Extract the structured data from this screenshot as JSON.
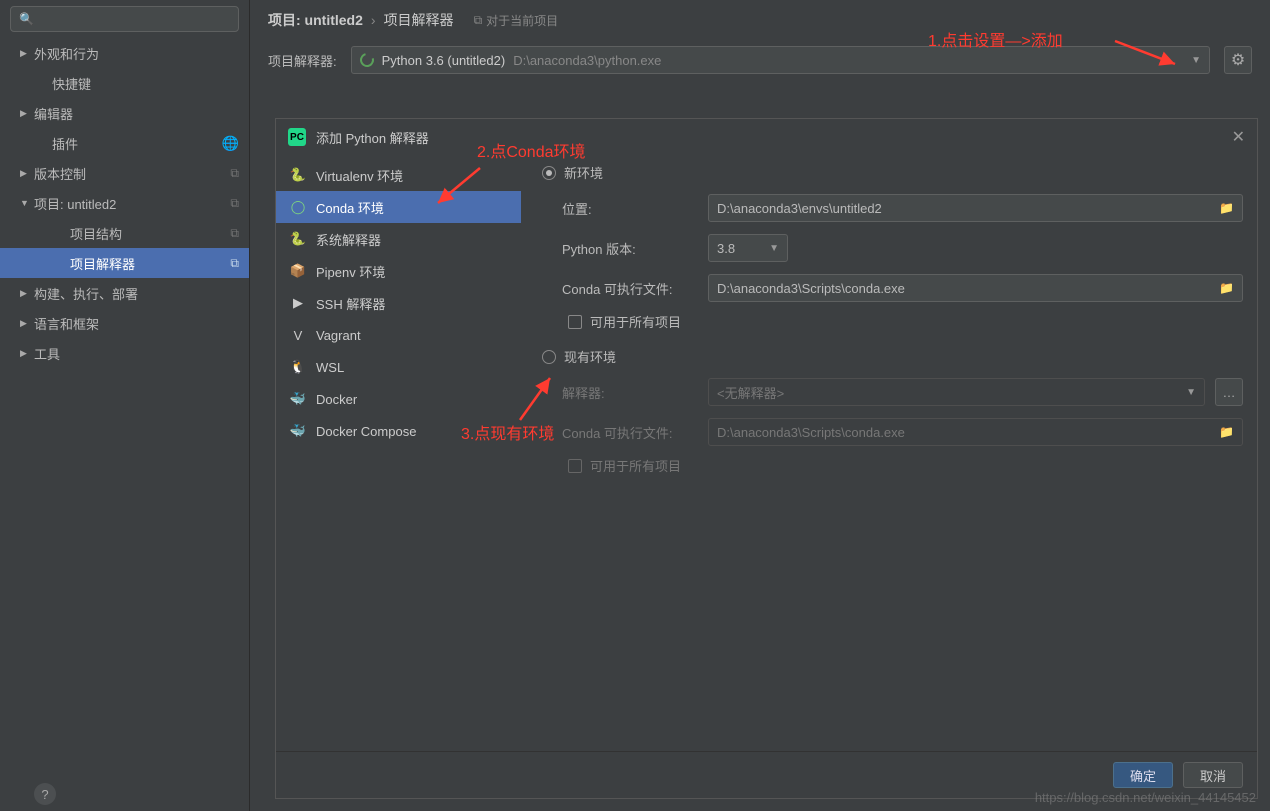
{
  "search": {
    "placeholder": ""
  },
  "sidebar": {
    "items": [
      {
        "label": "外观和行为",
        "chevron": "▶",
        "indent": 0
      },
      {
        "label": "快捷键",
        "chevron": "",
        "indent": 1
      },
      {
        "label": "编辑器",
        "chevron": "▶",
        "indent": 0
      },
      {
        "label": "插件",
        "chevron": "",
        "indent": 1,
        "lang": true
      },
      {
        "label": "版本控制",
        "chevron": "▶",
        "indent": 0,
        "copy": true
      },
      {
        "label": "项目: untitled2",
        "chevron": "▼",
        "indent": 0,
        "copy": true
      },
      {
        "label": "项目结构",
        "chevron": "",
        "indent": 2,
        "copy": true
      },
      {
        "label": "项目解释器",
        "chevron": "",
        "indent": 2,
        "copy": true,
        "selected": true
      },
      {
        "label": "构建、执行、部署",
        "chevron": "▶",
        "indent": 0
      },
      {
        "label": "语言和框架",
        "chevron": "▶",
        "indent": 0
      },
      {
        "label": "工具",
        "chevron": "▶",
        "indent": 0
      }
    ]
  },
  "header": {
    "crumb_root": "项目: untitled2",
    "crumb_sep": "›",
    "crumb_leaf": "项目解释器",
    "badge": "对于当前项目"
  },
  "interpreter": {
    "label": "项目解释器:",
    "name": "Python 3.6 (untitled2)",
    "path": "D:\\anaconda3\\python.exe"
  },
  "annotations": {
    "a1": "1.点击设置—>添加",
    "a2": "2.点Conda环境",
    "a3": "3.点现有环境"
  },
  "dialog": {
    "title": "添加 Python 解释器",
    "envs": [
      {
        "label": "Virtualenv 环境",
        "icon": "🐍"
      },
      {
        "label": "Conda 环境",
        "icon": "◯",
        "selected": true
      },
      {
        "label": "系统解释器",
        "icon": "🐍"
      },
      {
        "label": "Pipenv 环境",
        "icon": "📦"
      },
      {
        "label": "SSH 解释器",
        "icon": "▶"
      },
      {
        "label": "Vagrant",
        "icon": "V"
      },
      {
        "label": "WSL",
        "icon": "🐧"
      },
      {
        "label": "Docker",
        "icon": "🐳"
      },
      {
        "label": "Docker Compose",
        "icon": "🐳"
      }
    ],
    "radio_new": "新环境",
    "radio_existing": "现有环境",
    "field_location": "位置:",
    "field_location_value": "D:\\anaconda3\\envs\\untitled2",
    "field_pyver": "Python 版本:",
    "field_pyver_value": "3.8",
    "field_conda": "Conda 可执行文件:",
    "field_conda_value": "D:\\anaconda3\\Scripts\\conda.exe",
    "check_all": "可用于所有项目",
    "field_interp": "解释器:",
    "field_interp_value": "<无解释器>",
    "field_conda2": "Conda 可执行文件:",
    "field_conda2_value": "D:\\anaconda3\\Scripts\\conda.exe",
    "check_all2": "可用于所有项目",
    "ok": "确定",
    "cancel": "取消"
  },
  "watermark": "https://blog.csdn.net/weixin_44145452"
}
